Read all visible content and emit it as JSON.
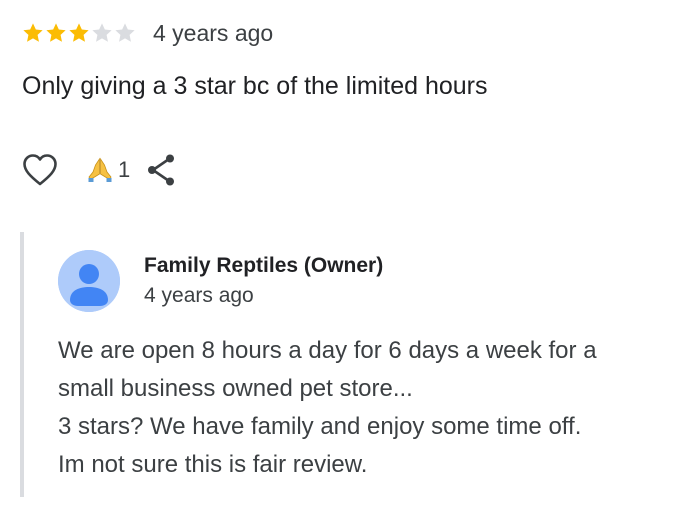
{
  "review": {
    "rating": 3,
    "rating_max": 5,
    "star_colors": {
      "filled": "#fbbc04",
      "empty": "#dadce0"
    },
    "timestamp": "4 years ago",
    "text": "Only giving a 3 star bc of the limited hours",
    "actions": {
      "like_icon": "heart-outline-icon",
      "reaction_icon": "praying-hands-icon",
      "reaction_count": "1",
      "share_icon": "share-icon"
    }
  },
  "owner_reply": {
    "name": "Family Reptiles (Owner)",
    "timestamp": "4 years ago",
    "avatar_icon": "person-avatar-icon",
    "avatar_color": "#aecbfa",
    "lines": [
      "We are open 8 hours a day for 6 days a week for a",
      "small business owned pet store...",
      "3 stars? We have family and enjoy some time off.",
      "Im not sure this is fair review."
    ]
  }
}
